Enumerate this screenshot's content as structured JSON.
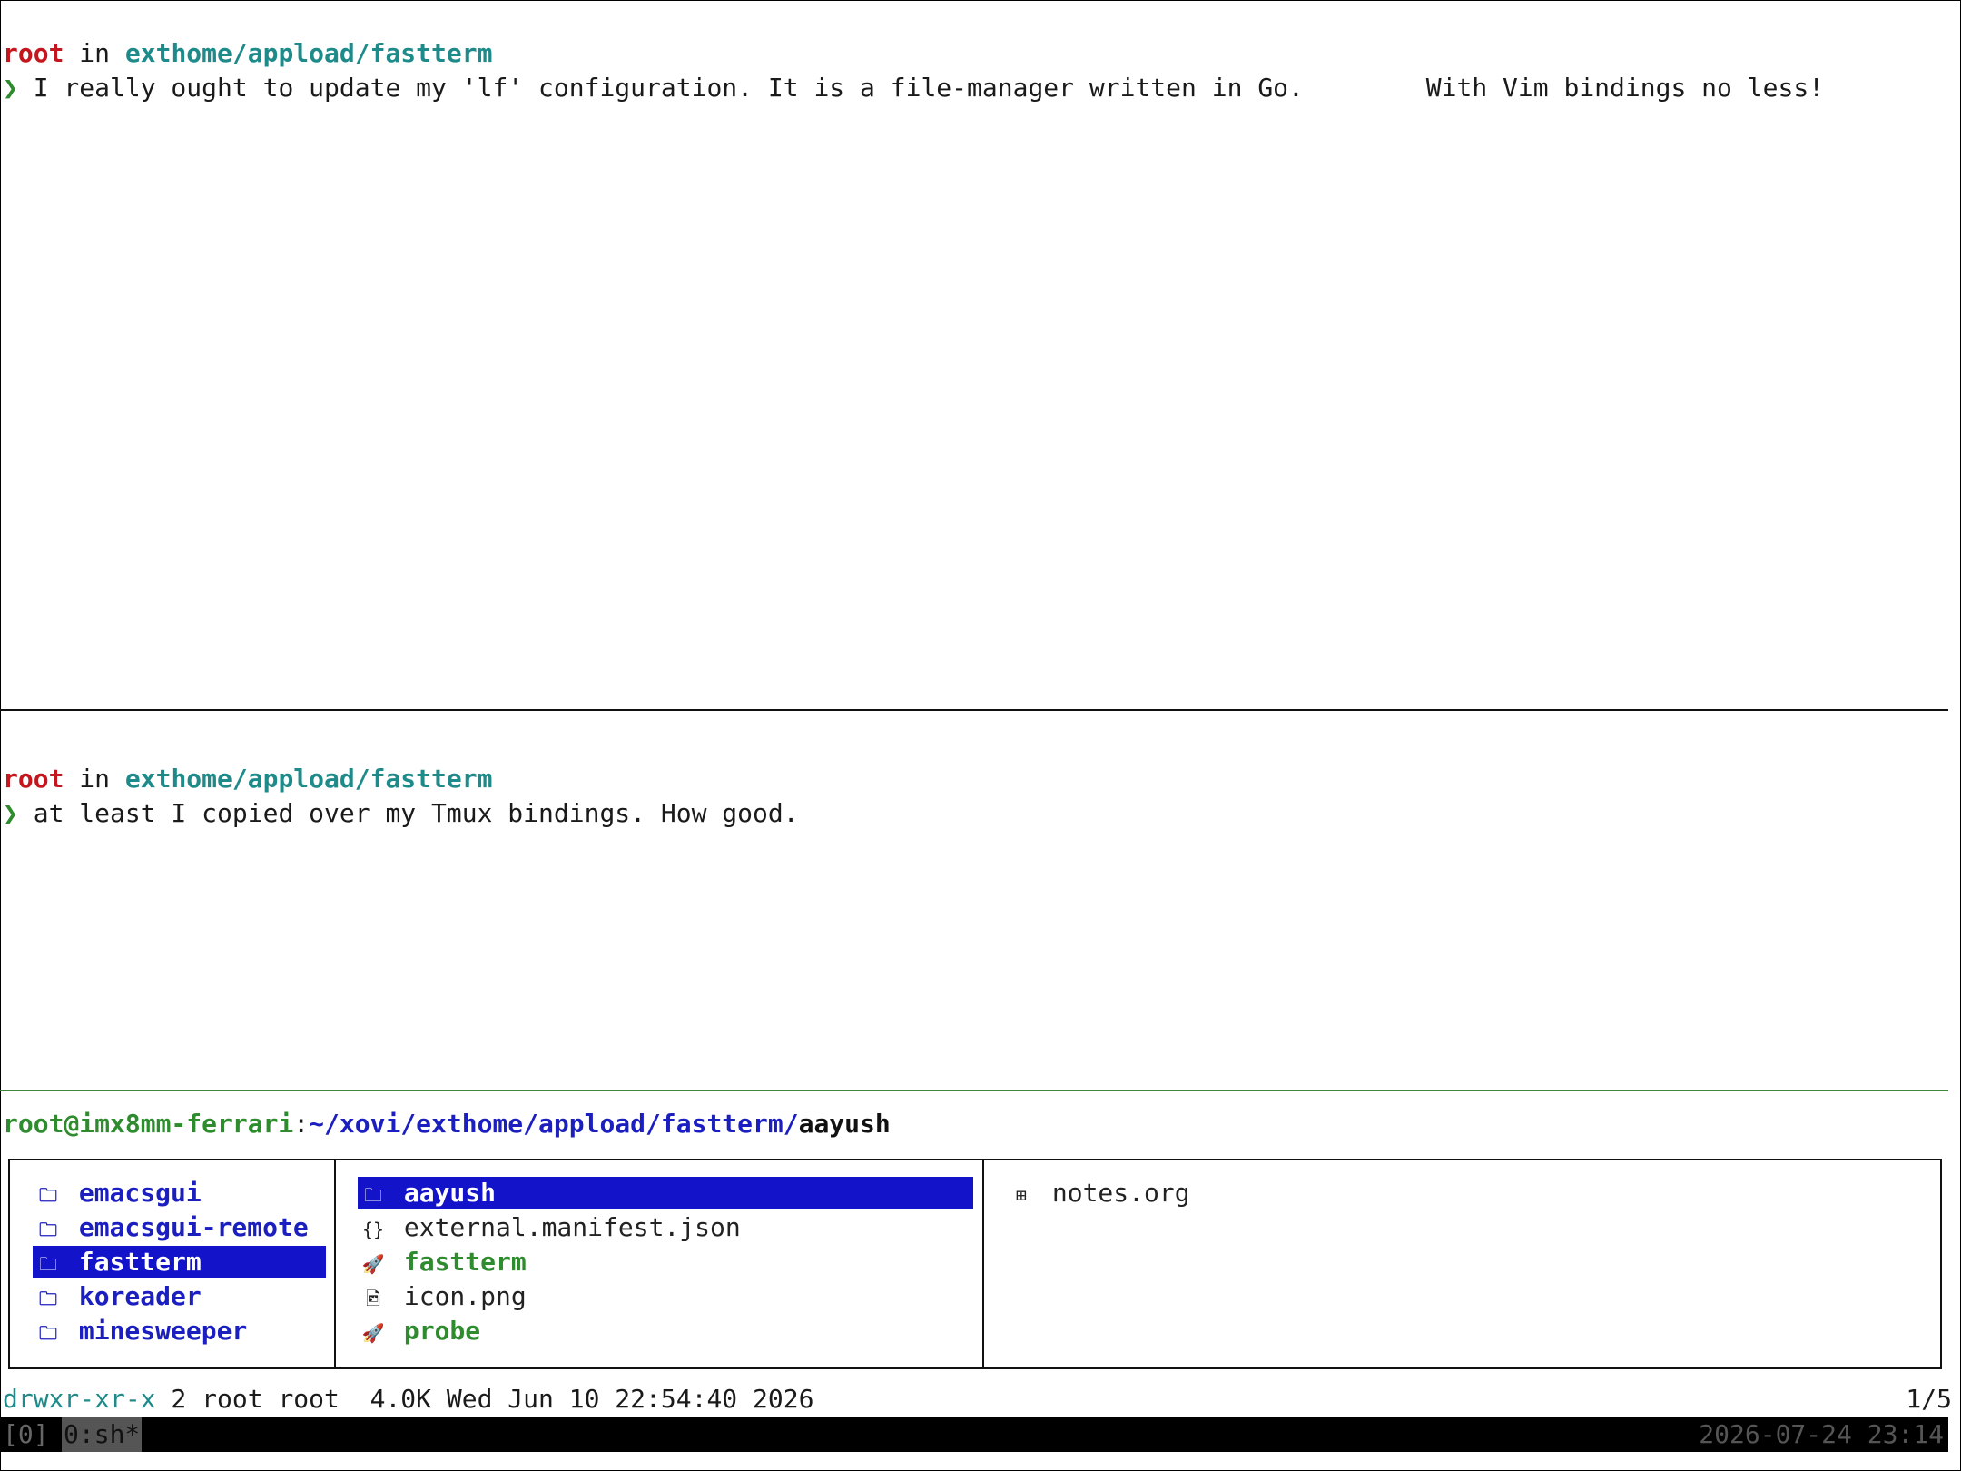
{
  "pane1": {
    "user": "root",
    "in": "in",
    "path": "exthome/appload/fastterm",
    "arrow": "❯",
    "command": "I really ought to update my 'lf' configuration. It is a file-manager written in Go.        With Vim bindings no less!"
  },
  "pane2": {
    "user": "root",
    "in": "in",
    "path": "exthome/appload/fastterm",
    "arrow": "❯",
    "command": "at least I copied over my Tmux bindings. How good."
  },
  "lf": {
    "header_user_host": "root@imx8mm-ferrari",
    "header_colon": ":",
    "header_path": "~/xovi/exthome/appload/fastterm/",
    "header_current": "aayush",
    "parent": [
      {
        "icon": "🗀",
        "name": "emacsgui"
      },
      {
        "icon": "🗀",
        "name": "emacsgui-remote"
      },
      {
        "icon": "🗀",
        "name": "fastterm"
      },
      {
        "icon": "🗀",
        "name": "koreader"
      },
      {
        "icon": "🗀",
        "name": "minesweeper"
      }
    ],
    "current": [
      {
        "icon": "🗀",
        "name": "aayush"
      },
      {
        "icon": "{}",
        "name": "external.manifest.json"
      },
      {
        "icon": "🚀",
        "name": "fastterm"
      },
      {
        "icon": "🖻",
        "name": "icon.png"
      },
      {
        "icon": "🚀",
        "name": "probe"
      }
    ],
    "preview": [
      {
        "icon": "⊞",
        "name": "notes.org"
      }
    ],
    "status_perm": "drwxr-xr-x",
    "status_rest": " 2 root root  4.0K Wed Jun 10 22:54:40 2026",
    "status_pos": "1/5"
  },
  "tmux": {
    "session": "[0]",
    "window": "0:sh*",
    "clock": "2026-07-24 23:14"
  },
  "colors": {
    "selection": "#1313c9",
    "directory": "#1c1fbf",
    "executable": "#2e8b2e",
    "user": "#c4161c",
    "path": "#1f8a8a"
  }
}
